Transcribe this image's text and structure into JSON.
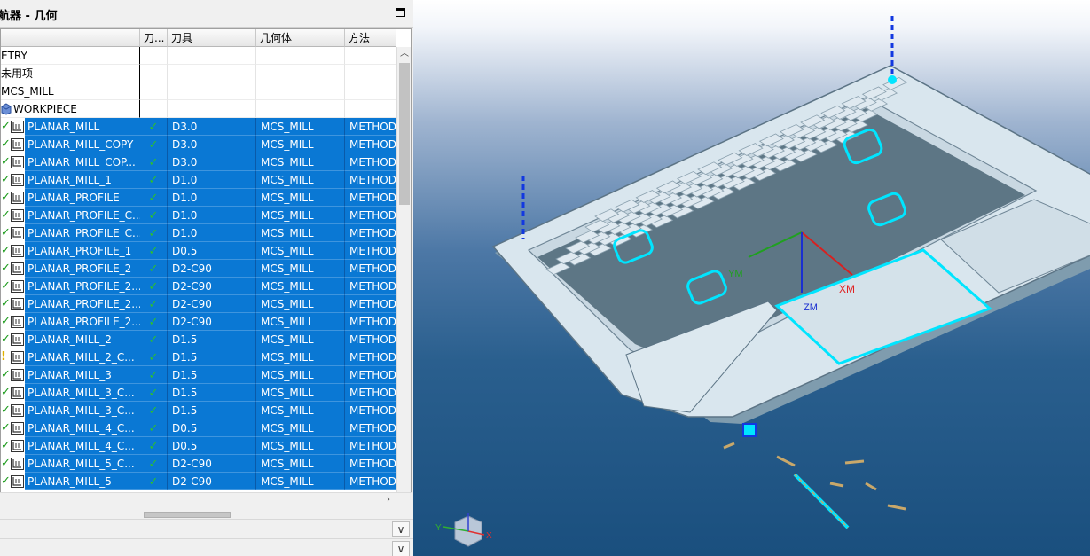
{
  "navigator": {
    "title": "航器 - 几何",
    "columns": [
      "刀...",
      "刀具",
      "几何体",
      "方法"
    ],
    "plain_rows": [
      {
        "name": "ETRY"
      },
      {
        "name": "未用项"
      },
      {
        "name": "MCS_MILL"
      },
      {
        "name": "WORKPIECE"
      }
    ],
    "operations": [
      {
        "name": "PLANAR_MILL",
        "cutter": "D3.0",
        "geometry": "MCS_MILL",
        "method": "METHOD",
        "status": "ok"
      },
      {
        "name": "PLANAR_MILL_COPY",
        "cutter": "D3.0",
        "geometry": "MCS_MILL",
        "method": "METHOD",
        "status": "ok"
      },
      {
        "name": "PLANAR_MILL_COP...",
        "cutter": "D3.0",
        "geometry": "MCS_MILL",
        "method": "METHOD",
        "status": "ok"
      },
      {
        "name": "PLANAR_MILL_1",
        "cutter": "D1.0",
        "geometry": "MCS_MILL",
        "method": "METHOD",
        "status": "ok"
      },
      {
        "name": "PLANAR_PROFILE",
        "cutter": "D1.0",
        "geometry": "MCS_MILL",
        "method": "METHOD",
        "status": "ok"
      },
      {
        "name": "PLANAR_PROFILE_C...",
        "cutter": "D1.0",
        "geometry": "MCS_MILL",
        "method": "METHOD",
        "status": "ok"
      },
      {
        "name": "PLANAR_PROFILE_C...",
        "cutter": "D1.0",
        "geometry": "MCS_MILL",
        "method": "METHOD",
        "status": "ok"
      },
      {
        "name": "PLANAR_PROFILE_1",
        "cutter": "D0.5",
        "geometry": "MCS_MILL",
        "method": "METHOD",
        "status": "ok"
      },
      {
        "name": "PLANAR_PROFILE_2",
        "cutter": "D2-C90",
        "geometry": "MCS_MILL",
        "method": "METHOD",
        "status": "ok"
      },
      {
        "name": "PLANAR_PROFILE_2...",
        "cutter": "D2-C90",
        "geometry": "MCS_MILL",
        "method": "METHOD",
        "status": "ok"
      },
      {
        "name": "PLANAR_PROFILE_2...",
        "cutter": "D2-C90",
        "geometry": "MCS_MILL",
        "method": "METHOD",
        "status": "ok"
      },
      {
        "name": "PLANAR_PROFILE_2...",
        "cutter": "D2-C90",
        "geometry": "MCS_MILL",
        "method": "METHOD",
        "status": "ok"
      },
      {
        "name": "PLANAR_MILL_2",
        "cutter": "D1.5",
        "geometry": "MCS_MILL",
        "method": "METHOD",
        "status": "ok"
      },
      {
        "name": "PLANAR_MILL_2_C...",
        "cutter": "D1.5",
        "geometry": "MCS_MILL",
        "method": "METHOD",
        "status": "warning"
      },
      {
        "name": "PLANAR_MILL_3",
        "cutter": "D1.5",
        "geometry": "MCS_MILL",
        "method": "METHOD",
        "status": "ok"
      },
      {
        "name": "PLANAR_MILL_3_C...",
        "cutter": "D1.5",
        "geometry": "MCS_MILL",
        "method": "METHOD",
        "status": "ok"
      },
      {
        "name": "PLANAR_MILL_3_C...",
        "cutter": "D1.5",
        "geometry": "MCS_MILL",
        "method": "METHOD",
        "status": "ok"
      },
      {
        "name": "PLANAR_MILL_4_C...",
        "cutter": "D0.5",
        "geometry": "MCS_MILL",
        "method": "METHOD",
        "status": "ok"
      },
      {
        "name": "PLANAR_MILL_4_C...",
        "cutter": "D0.5",
        "geometry": "MCS_MILL",
        "method": "METHOD",
        "status": "ok"
      },
      {
        "name": "PLANAR_MILL_5_C...",
        "cutter": "D2-C90",
        "geometry": "MCS_MILL",
        "method": "METHOD",
        "status": "ok"
      },
      {
        "name": "PLANAR_MILL_5",
        "cutter": "D2-C90",
        "geometry": "MCS_MILL",
        "method": "METHOD",
        "status": "ok"
      }
    ]
  },
  "viewport": {
    "labels": {
      "xm": "XM",
      "ym": "YM",
      "zm": "ZM"
    },
    "triad": {
      "x": "X",
      "y": "Y"
    },
    "colors": {
      "selection": "#0a78d4",
      "toolpath": "#00e5ff",
      "part": "#d9e6ee"
    }
  }
}
